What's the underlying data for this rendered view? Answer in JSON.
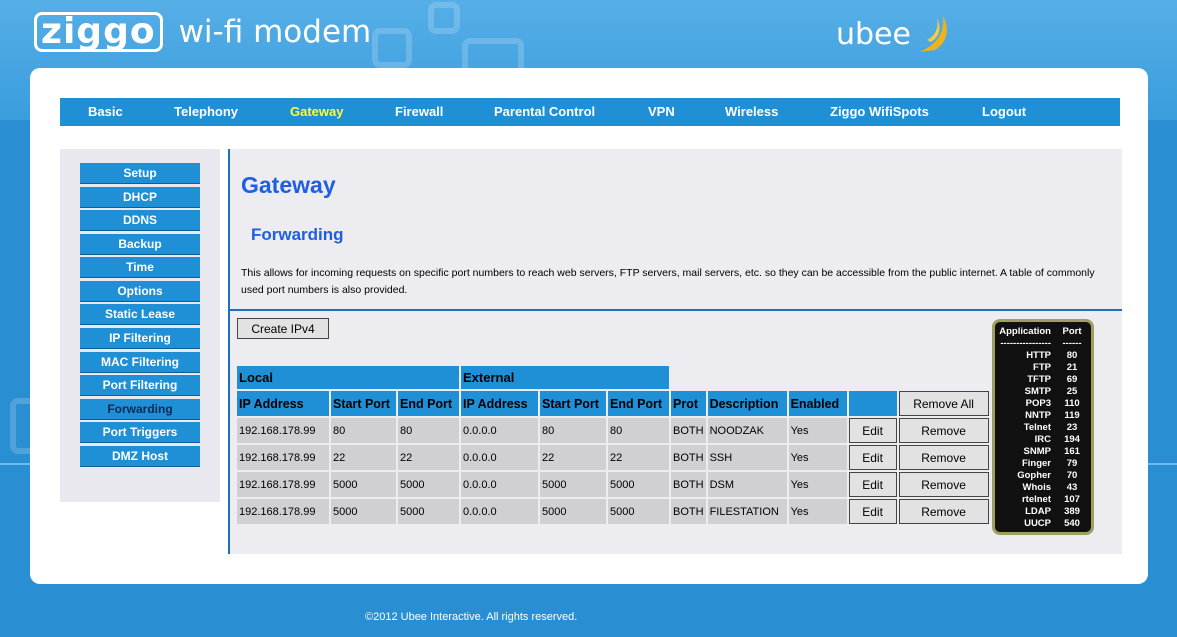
{
  "header": {
    "brand": "ziggo",
    "title": "wi-fi modem",
    "vendor": "ubee"
  },
  "topnav": [
    {
      "label": "Basic"
    },
    {
      "label": "Telephony"
    },
    {
      "label": "Gateway"
    },
    {
      "label": "Firewall"
    },
    {
      "label": "Parental Control"
    },
    {
      "label": "VPN"
    },
    {
      "label": "Wireless"
    },
    {
      "label": "Ziggo WifiSpots"
    },
    {
      "label": "Logout"
    }
  ],
  "topnav_active": "Gateway",
  "sidebar": [
    {
      "label": "Setup"
    },
    {
      "label": "DHCP"
    },
    {
      "label": "DDNS"
    },
    {
      "label": "Backup"
    },
    {
      "label": "Time"
    },
    {
      "label": "Options"
    },
    {
      "label": "Static Lease"
    },
    {
      "label": "IP Filtering"
    },
    {
      "label": "MAC Filtering"
    },
    {
      "label": "Port Filtering"
    },
    {
      "label": "Forwarding"
    },
    {
      "label": "Port Triggers"
    },
    {
      "label": "DMZ Host"
    }
  ],
  "sidebar_active": "Forwarding",
  "page": {
    "title": "Gateway",
    "subtitle": "Forwarding",
    "description": "This allows for incoming requests on specific port numbers to reach web servers, FTP servers, mail servers, etc. so they can be accessible from the public internet. A table of commonly used port numbers is also provided.",
    "create_button": "Create IPv4"
  },
  "table": {
    "group_local": "Local",
    "group_external": "External",
    "headers": [
      "IP Address",
      "Start Port",
      "End Port",
      "IP Address",
      "Start Port",
      "End Port",
      "Prot",
      "Description",
      "Enabled"
    ],
    "remove_all": "Remove All",
    "edit_label": "Edit",
    "remove_label": "Remove",
    "rows": [
      [
        "192.168.178.99",
        "80",
        "80",
        "0.0.0.0",
        "80",
        "80",
        "BOTH",
        "NOODZAK",
        "Yes"
      ],
      [
        "192.168.178.99",
        "22",
        "22",
        "0.0.0.0",
        "22",
        "22",
        "BOTH",
        "SSH",
        "Yes"
      ],
      [
        "192.168.178.99",
        "5000",
        "5000",
        "0.0.0.0",
        "5000",
        "5000",
        "BOTH",
        "DSM",
        "Yes"
      ],
      [
        "192.168.178.99",
        "5000",
        "5000",
        "0.0.0.0",
        "5000",
        "5000",
        "BOTH",
        "FILESTATION",
        "Yes"
      ]
    ]
  },
  "ports": {
    "head_app": "Application",
    "head_port": "Port",
    "dash_app": "----------------",
    "dash_port": "------",
    "rows": [
      [
        "HTTP",
        "80"
      ],
      [
        "FTP",
        "21"
      ],
      [
        "TFTP",
        "69"
      ],
      [
        "SMTP",
        "25"
      ],
      [
        "POP3",
        "110"
      ],
      [
        "NNTP",
        "119"
      ],
      [
        "Telnet",
        "23"
      ],
      [
        "IRC",
        "194"
      ],
      [
        "SNMP",
        "161"
      ],
      [
        "Finger",
        "79"
      ],
      [
        "Gopher",
        "70"
      ],
      [
        "Whois",
        "43"
      ],
      [
        "rtelnet",
        "107"
      ],
      [
        "LDAP",
        "389"
      ],
      [
        "UUCP",
        "540"
      ]
    ]
  },
  "footer": "©2012 Ubee Interactive. All rights reserved.",
  "colors": {
    "accent": "#1f8fd6",
    "active_nav": "#ffff33",
    "heading": "#1e5fe0"
  }
}
